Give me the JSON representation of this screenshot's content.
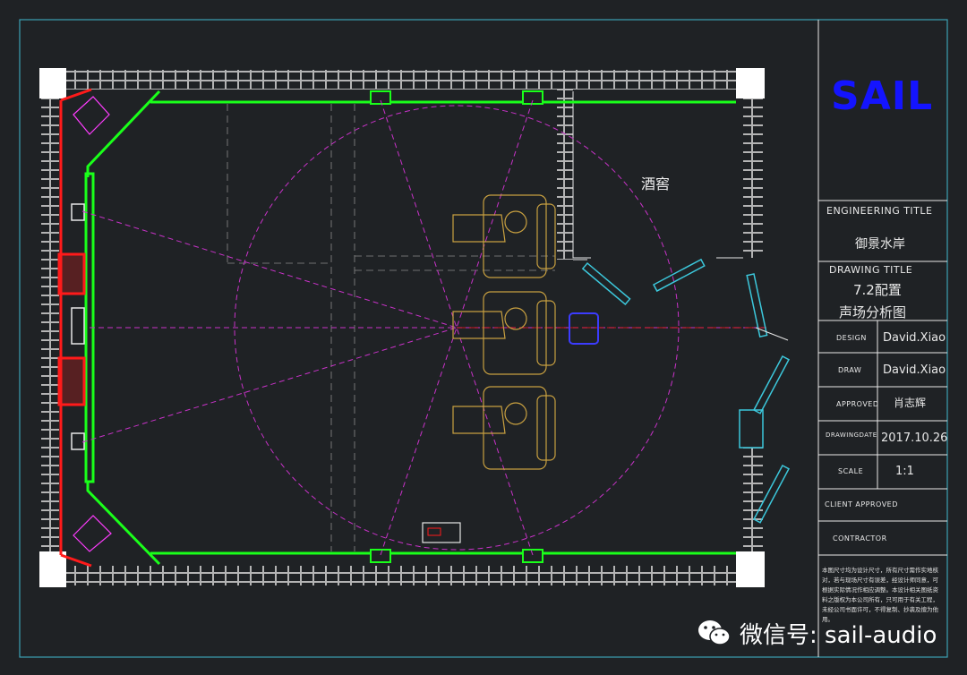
{
  "logo": "SAIL",
  "engineering_title_label": "ENGINEERING TITLE",
  "engineering_title": "御景水岸",
  "drawing_title_label": "DRAWING TITLE",
  "drawing_title_line1": "7.2配置",
  "drawing_title_line2": "声场分析图",
  "rows": [
    {
      "label": "DESIGN",
      "value": "David.Xiao"
    },
    {
      "label": "DRAW",
      "value": "David.Xiao"
    },
    {
      "label": "APPROVED",
      "value": "肖志辉"
    },
    {
      "label": "DRAWINGDATE",
      "value": "2017.10.26"
    },
    {
      "label": "SCALE",
      "value": "1:1"
    },
    {
      "label": "CLIENT APPROVED",
      "value": ""
    },
    {
      "label": "CONTRACTOR",
      "value": ""
    }
  ],
  "room_label": "酒窖",
  "note": "本图尺寸均为设计尺寸，所有尺寸需作实地核对，若与现场尺寸有误差，经设计师同意，可根据实际情况作相应调整。本设计相关图纸资料之版权为本公司所有，只可用于有关工程，未经公司书面许可，不得复制、抄袭及擅为他用。",
  "watermark": "微信号: sail-audio",
  "colors": {
    "background": "#1f2225",
    "wall_white": "#e6e6e6",
    "wall_green": "#1aff1a",
    "wall_red": "#ff1a1a",
    "acoustic_magenta": "#c832c8",
    "door_cyan": "#3cc8dc",
    "seat_yellow": "#c8a040",
    "logo_blue": "#1414ff"
  }
}
